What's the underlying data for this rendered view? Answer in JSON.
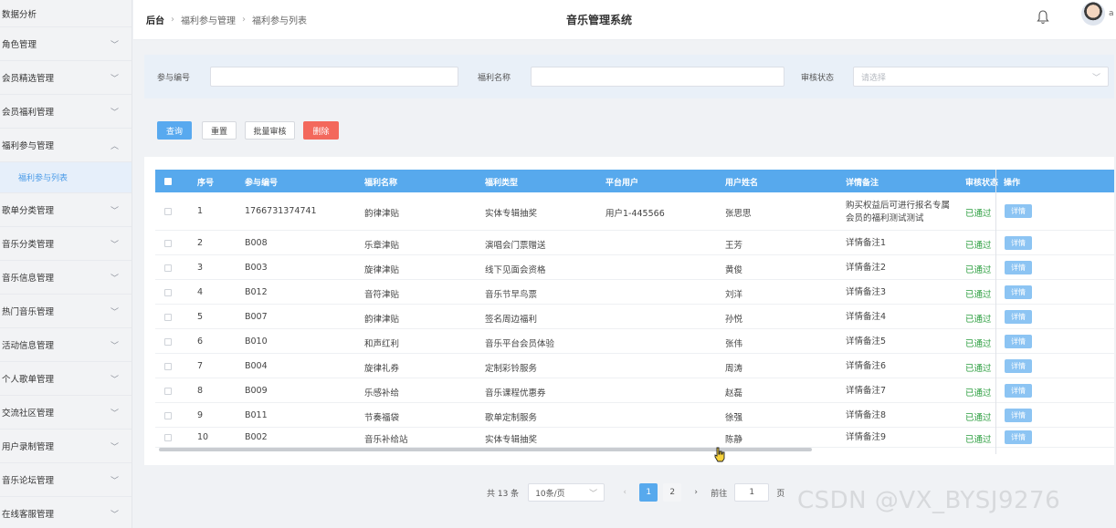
{
  "app": {
    "title": "音乐管理系统",
    "user_short": "a"
  },
  "breadcrumb": [
    "后台",
    "福利参与管理",
    "福利参与列表"
  ],
  "sidebar": {
    "items": [
      {
        "label": "数据分析",
        "expanded": null
      },
      {
        "label": "角色管理",
        "expanded": false
      },
      {
        "label": "会员精选管理",
        "expanded": false
      },
      {
        "label": "会员福利管理",
        "expanded": false
      },
      {
        "label": "福利参与管理",
        "expanded": true
      },
      {
        "label": "歌单分类管理",
        "expanded": false
      },
      {
        "label": "音乐分类管理",
        "expanded": false
      },
      {
        "label": "音乐信息管理",
        "expanded": false
      },
      {
        "label": "热门音乐管理",
        "expanded": false
      },
      {
        "label": "活动信息管理",
        "expanded": false
      },
      {
        "label": "个人歌单管理",
        "expanded": false
      },
      {
        "label": "交流社区管理",
        "expanded": false
      },
      {
        "label": "用户录制管理",
        "expanded": false
      },
      {
        "label": "音乐论坛管理",
        "expanded": false
      },
      {
        "label": "在线客服管理",
        "expanded": false
      }
    ],
    "active_sub": "福利参与列表"
  },
  "search": {
    "fields": {
      "participation_no": {
        "label": "参与编号",
        "value": ""
      },
      "benefit_name": {
        "label": "福利名称",
        "value": ""
      },
      "review_status": {
        "label": "审核状态",
        "placeholder": "请选择"
      }
    }
  },
  "actions": {
    "query": "查询",
    "reset": "重置",
    "batch_review": "批量审核",
    "delete": "删除"
  },
  "table": {
    "headers": [
      "序号",
      "参与编号",
      "福利名称",
      "福利类型",
      "平台用户",
      "用户姓名",
      "详情备注",
      "审核状态",
      "操作"
    ],
    "rows": [
      {
        "index": "1",
        "no": "1766731374741",
        "name": "韵律津贴",
        "type": "实体专辑抽奖",
        "platform_user": "用户1-445566",
        "user_name": "张思思",
        "note_line1": "购买权益后可进行报名专属",
        "note_line2": "会员的福利测试测试",
        "status": "已通过",
        "action": "详情"
      },
      {
        "index": "2",
        "no": "B008",
        "name": "乐章津贴",
        "type": "演唱会门票赠送",
        "platform_user": "",
        "user_name": "王芳",
        "note_line1": "详情备注1",
        "note_line2": "",
        "status": "已通过",
        "action": "详情"
      },
      {
        "index": "3",
        "no": "B003",
        "name": "旋律津贴",
        "type": "线下见面会资格",
        "platform_user": "",
        "user_name": "黄俊",
        "note_line1": "详情备注2",
        "note_line2": "",
        "status": "已通过",
        "action": "详情"
      },
      {
        "index": "4",
        "no": "B012",
        "name": "音符津贴",
        "type": "音乐节早鸟票",
        "platform_user": "",
        "user_name": "刘洋",
        "note_line1": "详情备注3",
        "note_line2": "",
        "status": "已通过",
        "action": "详情"
      },
      {
        "index": "5",
        "no": "B007",
        "name": "韵律津贴",
        "type": "签名周边福利",
        "platform_user": "",
        "user_name": "孙悦",
        "note_line1": "详情备注4",
        "note_line2": "",
        "status": "已通过",
        "action": "详情"
      },
      {
        "index": "6",
        "no": "B010",
        "name": "和声红利",
        "type": "音乐平台会员体验",
        "platform_user": "",
        "user_name": "张伟",
        "note_line1": "详情备注5",
        "note_line2": "",
        "status": "已通过",
        "action": "详情"
      },
      {
        "index": "7",
        "no": "B004",
        "name": "旋律礼券",
        "type": "定制彩铃服务",
        "platform_user": "",
        "user_name": "周涛",
        "note_line1": "详情备注6",
        "note_line2": "",
        "status": "已通过",
        "action": "详情"
      },
      {
        "index": "8",
        "no": "B009",
        "name": "乐感补给",
        "type": "音乐课程优惠券",
        "platform_user": "",
        "user_name": "赵磊",
        "note_line1": "详情备注7",
        "note_line2": "",
        "status": "已通过",
        "action": "详情"
      },
      {
        "index": "9",
        "no": "B011",
        "name": "节奏福袋",
        "type": "歌单定制服务",
        "platform_user": "",
        "user_name": "徐强",
        "note_line1": "详情备注8",
        "note_line2": "",
        "status": "已通过",
        "action": "详情"
      },
      {
        "index": "10",
        "no": "B002",
        "name": "音乐补给站",
        "type": "实体专辑抽奖",
        "platform_user": "",
        "user_name": "陈静",
        "note_line1": "详情备注9",
        "note_line2": "",
        "status": "已通过",
        "action": "详情"
      }
    ]
  },
  "pagination": {
    "total": "共 13 条",
    "page_size": "10条/页",
    "pages": [
      "1",
      "2"
    ],
    "current": "1",
    "goto_label": "前往",
    "goto_value": "1",
    "page_unit": "页"
  },
  "watermark": "CSDN @VX_BYSJ9276",
  "colors": {
    "primary": "#57a9ed",
    "danger": "#f3685c",
    "success": "#2a9d3e",
    "sidebar_active": "#4a9be8"
  }
}
